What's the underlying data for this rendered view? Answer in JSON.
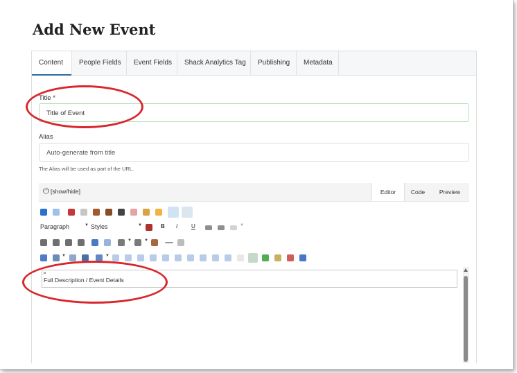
{
  "page": {
    "title": "Add New Event"
  },
  "tabs": [
    {
      "label": "Content",
      "active": true
    },
    {
      "label": "People Fields"
    },
    {
      "label": "Event Fields"
    },
    {
      "label": "Shack Analytics Tag"
    },
    {
      "label": "Publishing"
    },
    {
      "label": "Metadata"
    }
  ],
  "form": {
    "title_label": "Title *",
    "title_value": "Title of Event",
    "alias_label": "Alias",
    "alias_placeholder": "Auto-generate from title",
    "alias_help": "The Alias will be used as part of the URL."
  },
  "editor": {
    "toggle_label": "[show/hide]",
    "tabs": [
      {
        "label": "Editor",
        "active": true
      },
      {
        "label": "Code"
      },
      {
        "label": "Preview"
      }
    ],
    "format_select": "Paragraph",
    "styles_select": "Styles",
    "bold_label": "B",
    "italic_label": "I",
    "underline_label": "U",
    "path_text": "p",
    "content_text": "Full Description / Event Details"
  },
  "colors": {
    "active_tab_underline": "#2a6aa3",
    "annotation": "#d9262c"
  }
}
